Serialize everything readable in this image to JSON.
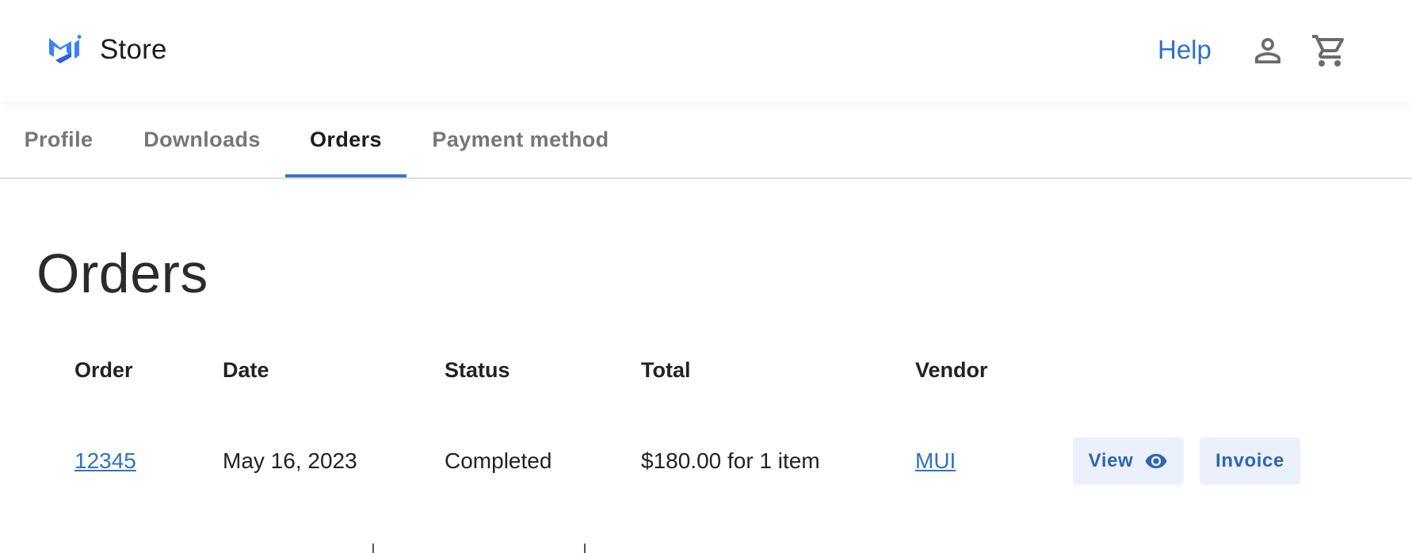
{
  "header": {
    "brand": "Store",
    "help_label": "Help",
    "logo_icon": "mui-logo-icon",
    "account_icon": "account-icon",
    "cart_icon": "cart-icon",
    "accent_color": "#2f72c4"
  },
  "tabs": [
    {
      "label": "Profile",
      "active": false
    },
    {
      "label": "Downloads",
      "active": false
    },
    {
      "label": "Orders",
      "active": true
    },
    {
      "label": "Payment method",
      "active": false
    }
  ],
  "main": {
    "title": "Orders",
    "table": {
      "columns": [
        "Order",
        "Date",
        "Status",
        "Total",
        "Vendor"
      ],
      "rows": [
        {
          "order": "12345",
          "date": "May 16, 2023",
          "status": "Completed",
          "total": "$180.00 for 1 item",
          "vendor": "MUI",
          "view_label": "View",
          "view_icon": "eye-icon",
          "invoice_label": "Invoice"
        }
      ]
    }
  }
}
